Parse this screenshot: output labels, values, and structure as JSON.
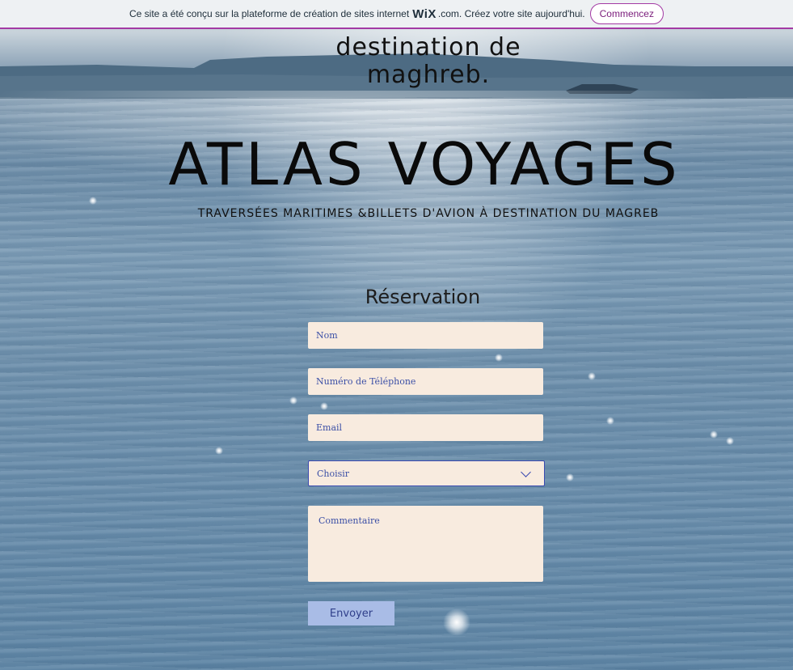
{
  "banner": {
    "text_before": "Ce site a été conçu sur la plateforme de création de sites internet",
    "logo": "WiX",
    "text_after": ".com. Créez votre site aujourd'hui.",
    "cta_label": "Commencez"
  },
  "hero": {
    "tagline_line1": "destination de",
    "tagline_line2": "maghreb.",
    "title": "ATLAS VOYAGES",
    "subtitle": "TRAVERSÉES MARITIMES &BILLETS D'AVION À DESTINATION DU MAGREB"
  },
  "form": {
    "title": "Réservation",
    "name_placeholder": "Nom",
    "phone_placeholder": "Numéro de Téléphone",
    "email_placeholder": "Email",
    "select_value": "Choisir",
    "comment_placeholder": "Commentaire",
    "submit_label": "Envoyer"
  },
  "colors": {
    "banner_accent": "#a33aa4",
    "field_background": "#f8ebdf",
    "field_text": "#3b4fa6",
    "submit_background": "#a9bce6"
  },
  "icons": {
    "select": "chevron-down-icon"
  }
}
